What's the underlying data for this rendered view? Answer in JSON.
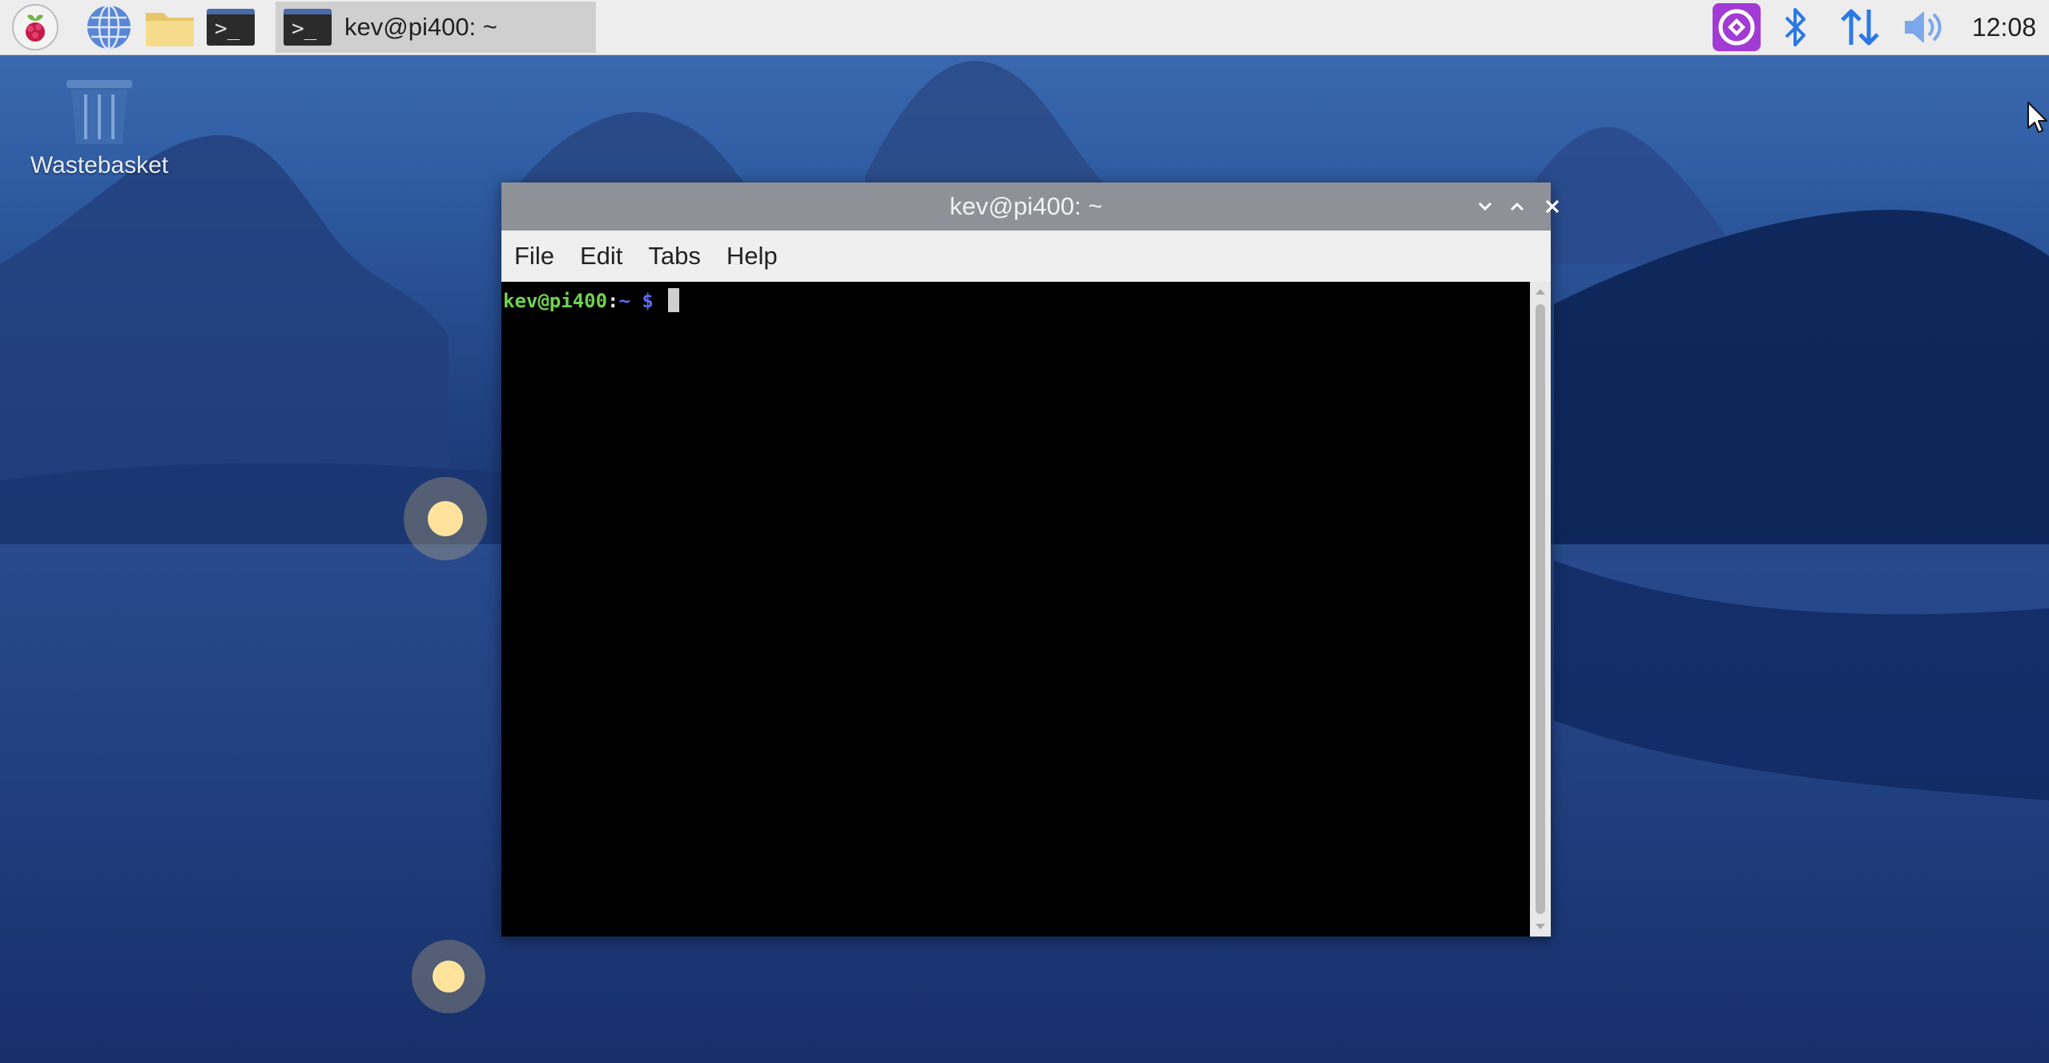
{
  "taskbar": {
    "launchers": [
      {
        "name": "menu",
        "icon": "raspberry-icon"
      },
      {
        "name": "web-browser",
        "icon": "globe-icon"
      },
      {
        "name": "file-manager",
        "icon": "folder-icon"
      },
      {
        "name": "terminal",
        "icon": "terminal-icon",
        "glyph": ">_"
      }
    ],
    "active_task": {
      "label": "kev@pi400: ~",
      "glyph": ">_"
    },
    "tray": [
      {
        "name": "vnc",
        "icon": "vnc-icon",
        "color": "#a23bd6"
      },
      {
        "name": "bluetooth",
        "icon": "bluetooth-icon",
        "color": "#2b78e4"
      },
      {
        "name": "network",
        "icon": "network-updown-icon",
        "color": "#2b78e4"
      },
      {
        "name": "volume",
        "icon": "speaker-icon",
        "color": "#2b78e4"
      }
    ],
    "clock": "12:08"
  },
  "desktop": {
    "icons": [
      {
        "label": "Wastebasket",
        "icon": "trash-icon"
      }
    ]
  },
  "window": {
    "title": "kev@pi400: ~",
    "controls": [
      "minimize",
      "maximize",
      "close"
    ],
    "menu": [
      {
        "label": "File"
      },
      {
        "label": "Edit"
      },
      {
        "label": "Tabs"
      },
      {
        "label": "Help"
      }
    ],
    "terminal": {
      "prompt_user": "kev@pi400",
      "prompt_sep": ":",
      "prompt_path": "~",
      "prompt_symbol": " $ ",
      "user_color": "#6fd24f",
      "path_color": "#5b6cf0"
    }
  },
  "colors": {
    "taskbar_bg": "#ededed",
    "titlebar_bg": "#8e9298",
    "console_bg": "#000000"
  }
}
